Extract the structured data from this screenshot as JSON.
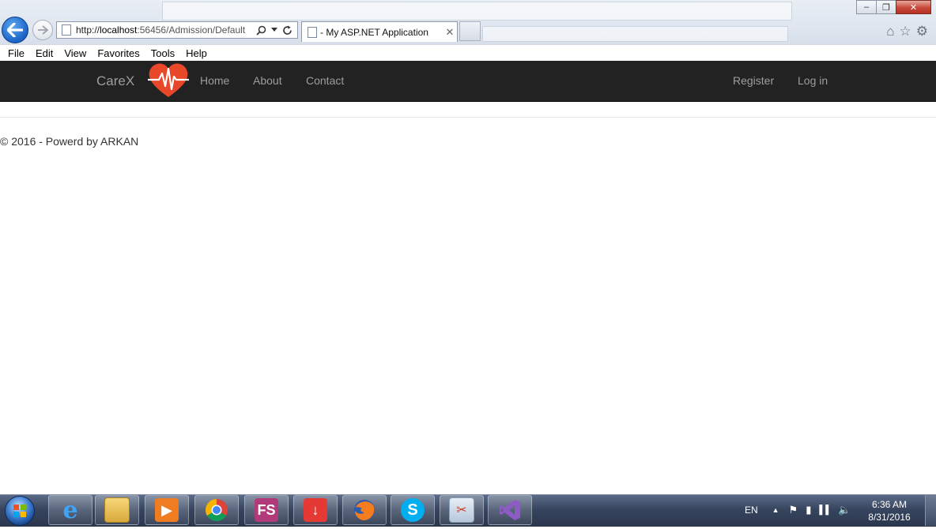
{
  "browser": {
    "address_url": "http://localhost:56456/Admission/Default",
    "url_scheme": "http://",
    "url_host": "localhost",
    "url_rest": ":56456/Admission/Default",
    "tab_title": "- My ASP.NET Application",
    "menu": [
      "File",
      "Edit",
      "View",
      "Favorites",
      "Tools",
      "Help"
    ]
  },
  "navbar": {
    "brand": "CareX",
    "left_links": [
      "Home",
      "About",
      "Contact"
    ],
    "right_links": [
      "Register",
      "Log in"
    ],
    "logo_icon": "heart-pulse-icon",
    "bg_color": "#222222",
    "link_color": "#9d9d9d",
    "logo_color": "#e8472a"
  },
  "footer": {
    "text": "© 2016 - Powerd by ARKAN"
  },
  "taskbar": {
    "apps": [
      "internet-explorer-icon",
      "file-explorer-icon",
      "media-player-icon",
      "chrome-icon",
      "fs-icon",
      "download-icon",
      "firefox-icon",
      "skype-icon",
      "snipping-tool-icon",
      "visual-studio-icon"
    ],
    "fs_label": "FS",
    "language": "EN",
    "time": "6:36 AM",
    "date": "8/31/2016"
  }
}
